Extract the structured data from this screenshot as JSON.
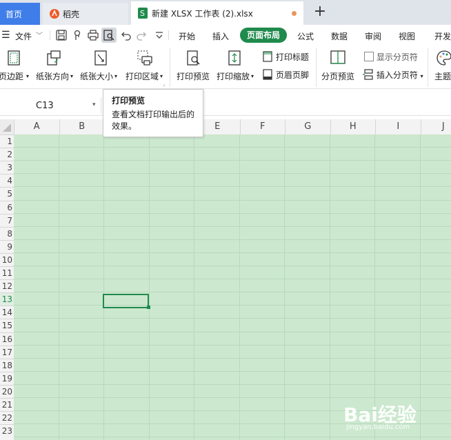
{
  "tabs": {
    "home": "首页",
    "daoke": "稻壳",
    "file": "新建 XLSX 工作表 (2).xlsx"
  },
  "menu": {
    "file_menu": "文件",
    "items": [
      "开始",
      "插入",
      "页面布局",
      "公式",
      "数据",
      "审阅",
      "视图",
      "开发"
    ],
    "active": "页面布局"
  },
  "ribbon": {
    "margins": "页边距",
    "orientation": "纸张方向",
    "size": "纸张大小",
    "print_area": "打印区域",
    "print_preview": "打印预览",
    "print_scale": "打印缩放",
    "print_titles": "打印标题",
    "header_footer": "页眉页脚",
    "page_break_preview": "分页预览",
    "show_page_breaks": "显示分页符",
    "insert_page_break": "插入分页符",
    "theme": "主题"
  },
  "tooltip": {
    "title": "打印预览",
    "description": "查看文档打印输出后的效果。"
  },
  "formula_bar": {
    "name_box": "C13"
  },
  "grid": {
    "columns": [
      "A",
      "B",
      "C",
      "D",
      "E",
      "F",
      "G",
      "H",
      "I",
      "J"
    ],
    "rows": [
      "1",
      "2",
      "3",
      "4",
      "5",
      "6",
      "7",
      "8",
      "9",
      "10",
      "11",
      "12",
      "13",
      "14",
      "15",
      "16",
      "17",
      "18",
      "19",
      "20",
      "21",
      "22",
      "23"
    ],
    "active_cell": "C13",
    "fill_color": "#cce8cf"
  },
  "watermark": {
    "text": "Bai经验",
    "sub": "jingyan.baidu.com"
  },
  "colors": {
    "accent": "#1f8a4c",
    "home_tab": "#3f7ee8"
  }
}
